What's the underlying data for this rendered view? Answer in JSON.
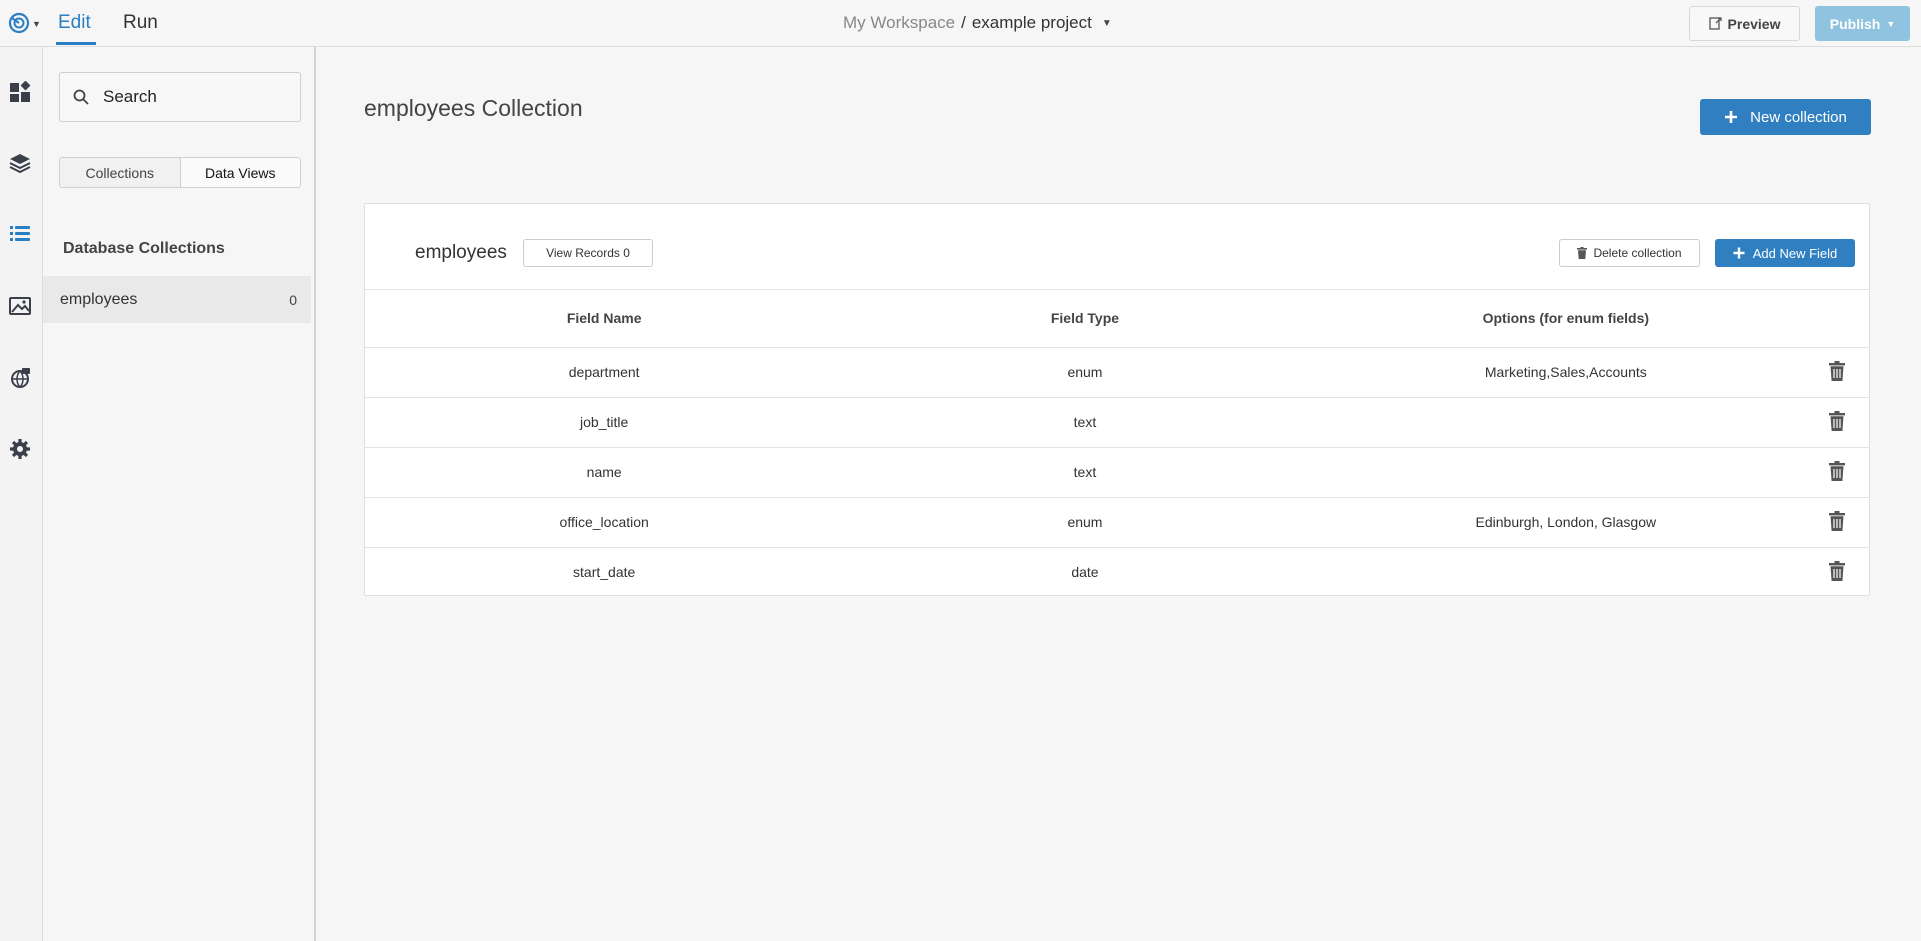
{
  "topbar": {
    "tabs": {
      "edit": "Edit",
      "run": "Run"
    },
    "breadcrumb": {
      "workspace": "My Workspace",
      "separator": "/",
      "project": "example project"
    },
    "preview_label": "Preview",
    "publish_label": "Publish"
  },
  "rail": {
    "icons": [
      "dashboard-icon",
      "layers-icon",
      "database-list-icon",
      "image-icon",
      "api-icon",
      "settings-icon"
    ]
  },
  "sidebar": {
    "search": {
      "placeholder": "Search",
      "value": ""
    },
    "segments": {
      "collections": "Collections",
      "data_views": "Data Views"
    },
    "section_title": "Database Collections",
    "items": [
      {
        "label": "employees",
        "count": "0"
      }
    ]
  },
  "main": {
    "title": "employees Collection",
    "new_collection_label": "New collection",
    "collection": {
      "name": "employees",
      "view_records_label": "View Records 0",
      "delete_label": "Delete collection",
      "add_field_label": "Add New Field",
      "columns": [
        "Field Name",
        "Field Type",
        "Options (for enum fields)"
      ],
      "rows": [
        {
          "name": "department",
          "type": "enum",
          "options": "Marketing,Sales,Accounts"
        },
        {
          "name": "job_title",
          "type": "text",
          "options": ""
        },
        {
          "name": "name",
          "type": "text",
          "options": ""
        },
        {
          "name": "office_location",
          "type": "enum",
          "options": "Edinburgh, London, Glasgow"
        },
        {
          "name": "start_date",
          "type": "date",
          "options": ""
        }
      ]
    }
  },
  "colors": {
    "accent": "#2a7fc4",
    "primary_button": "#2f7fc1",
    "publish_disabled": "#8fc3e0"
  }
}
